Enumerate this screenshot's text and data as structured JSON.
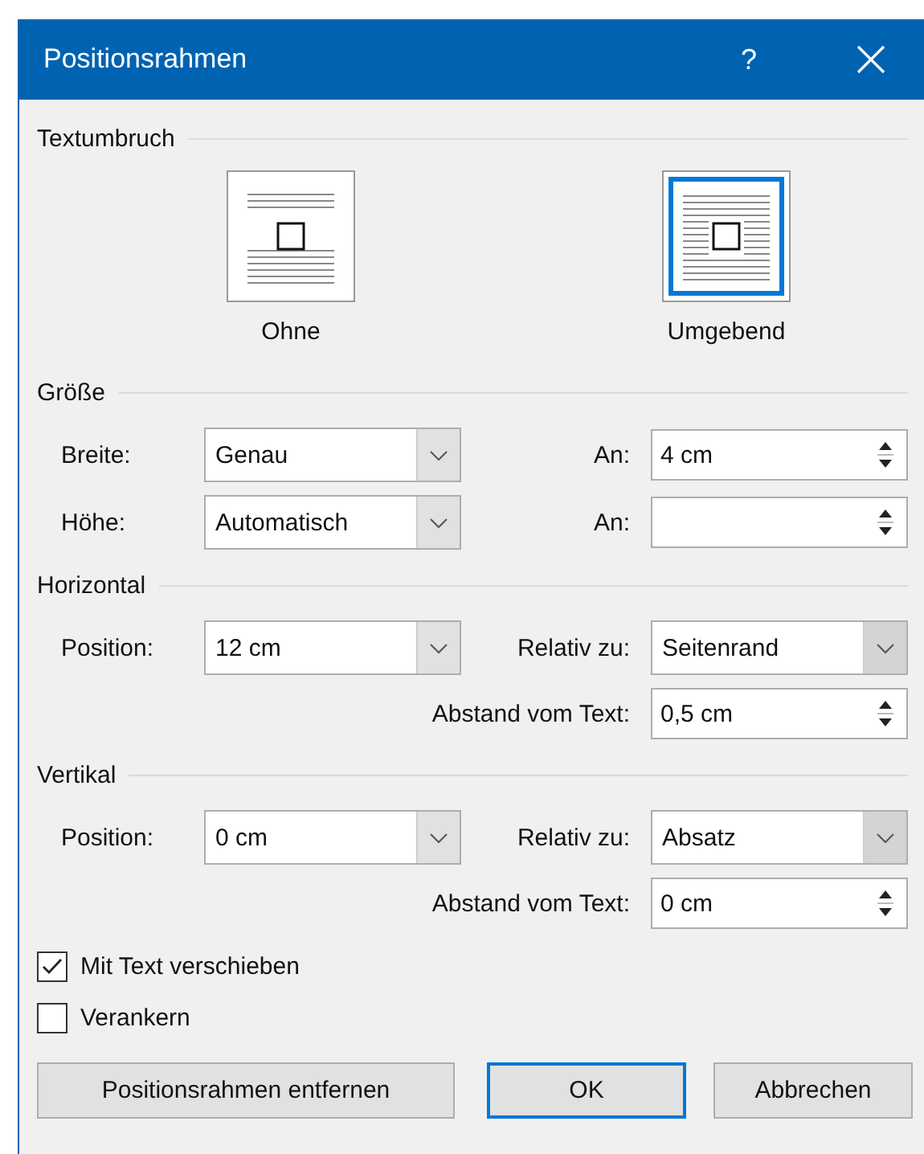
{
  "window": {
    "title": "Positionsrahmen",
    "help": "?"
  },
  "wrap": {
    "heading": "Textumbruch",
    "options": [
      {
        "label": "Ohne",
        "kind": "none",
        "selected": false
      },
      {
        "label": "Umgebend",
        "kind": "around",
        "selected": true
      }
    ]
  },
  "size": {
    "heading": "Größe",
    "rows": [
      {
        "label": "Breite:",
        "value": "Genau",
        "at_label": "An:",
        "at_value": "4 cm"
      },
      {
        "label": "Höhe:",
        "value": "Automatisch",
        "at_label": "An:"
      }
    ]
  },
  "horizontal": {
    "heading": "Horizontal",
    "position": {
      "label": "Position:",
      "value": "12 cm"
    },
    "relative": {
      "label": "Relativ zu:",
      "value": "Seitenrand"
    },
    "distance": {
      "label": "Abstand vom Text:",
      "value": "0,5 cm"
    }
  },
  "vertical": {
    "heading": "Vertikal",
    "position": {
      "label": "Position:",
      "value": "0 cm"
    },
    "relative": {
      "label": "Relativ zu:",
      "value": "Absatz"
    },
    "distance": {
      "label": "Abstand vom Text:",
      "value": "0 cm"
    }
  },
  "options": [
    {
      "label": "Mit Text verschieben",
      "checked": true
    },
    {
      "label": "Verankern",
      "checked": false
    }
  ],
  "buttons": [
    {
      "label": "Positionsrahmen entfernen",
      "default": false
    },
    {
      "label": "OK",
      "default": true
    },
    {
      "label": "Abbrechen",
      "default": false
    }
  ]
}
